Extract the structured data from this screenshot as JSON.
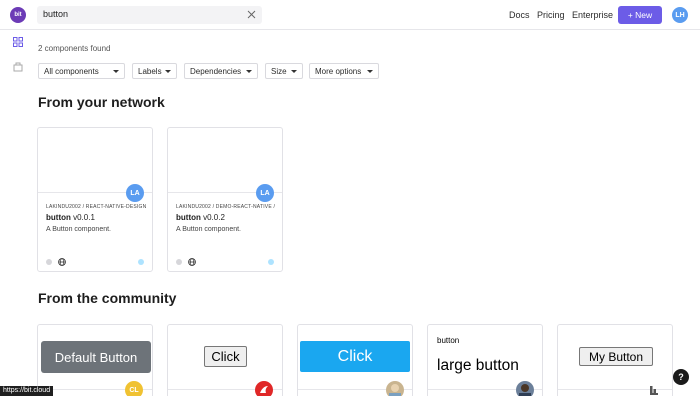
{
  "header": {
    "logo_text": "bit",
    "search_value": "button",
    "nav": [
      "Docs",
      "Pricing",
      "Enterprise"
    ],
    "new_button": "+ New",
    "user_initials": "LH",
    "accent": "#6c5ce7"
  },
  "results": {
    "count_text": "2 components found"
  },
  "filters": [
    "All components",
    "Labels",
    "Dependencies",
    "Size",
    "More options"
  ],
  "sections": {
    "network": "From your network",
    "community": "From the community"
  },
  "network_cards": [
    {
      "avatar": "LA",
      "path": "LAKINDU2002 / REACT-NATIVE-DESIGN...",
      "name": "button",
      "version": "v0.0.1",
      "description": "A Button component."
    },
    {
      "avatar": "LA",
      "path": "LAKINDU2002 / DEMO-REACT-NATIVE / ...",
      "name": "button",
      "version": "v0.0.2",
      "description": "A Button component."
    }
  ],
  "community_cards": [
    {
      "preview": "Default Button",
      "avatar": "CL"
    },
    {
      "preview": "Click"
    },
    {
      "preview": "Click"
    },
    {
      "preview_small": "button",
      "preview": "large button"
    },
    {
      "preview": "My Button"
    }
  ],
  "status_url": "https://bit.cloud",
  "help_label": "?"
}
